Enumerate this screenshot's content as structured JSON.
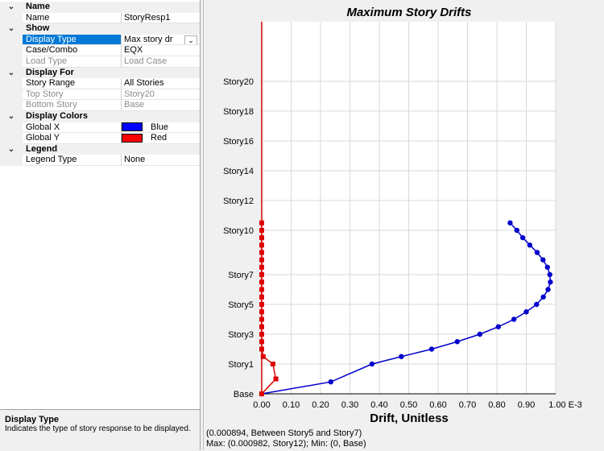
{
  "properties": [
    {
      "type": "cat",
      "label": "Name"
    },
    {
      "type": "row",
      "name": "Name",
      "value": "StoryResp1"
    },
    {
      "type": "cat",
      "label": "Show"
    },
    {
      "type": "row",
      "name": "Display Type",
      "value": "Max story dr",
      "selected": true,
      "dropdown": true
    },
    {
      "type": "row",
      "name": "Case/Combo",
      "value": "EQX"
    },
    {
      "type": "row",
      "name": "Load Type",
      "value": "Load Case",
      "dim": true
    },
    {
      "type": "cat",
      "label": "Display For"
    },
    {
      "type": "row",
      "name": "Story Range",
      "value": "All Stories"
    },
    {
      "type": "row",
      "name": "Top Story",
      "value": "Story20",
      "dim": true
    },
    {
      "type": "row",
      "name": "Bottom Story",
      "value": "Base",
      "dim": true
    },
    {
      "type": "cat",
      "label": "Display Colors"
    },
    {
      "type": "row",
      "name": "Global X",
      "value": "Blue",
      "swatch": "#0000ff"
    },
    {
      "type": "row",
      "name": "Global Y",
      "value": "Red",
      "swatch": "#ff0000"
    },
    {
      "type": "cat",
      "label": "Legend"
    },
    {
      "type": "row",
      "name": "Legend Type",
      "value": "None"
    }
  ],
  "description": {
    "title": "Display Type",
    "text": "Indicates the type of story response to be displayed."
  },
  "status": {
    "line1": "(0.000894, Between Story5 and Story7)",
    "line2": "Max: (0.000982, Story12);  Min: (0, Base)"
  },
  "chart_data": {
    "type": "line",
    "title": "Maximum Story Drifts",
    "xlabel": "Drift, Unitless",
    "xlim": [
      0,
      1.0
    ],
    "x_ticks": [
      "0.00",
      "0.10",
      "0.20",
      "0.30",
      "0.40",
      "0.50",
      "0.60",
      "0.70",
      "0.80",
      "0.90",
      "1.00 E-3"
    ],
    "y_labels": [
      {
        "label": "Base",
        "level": 0
      },
      {
        "label": "Story1",
        "level": 1
      },
      {
        "label": "Story3",
        "level": 3
      },
      {
        "label": "Story5",
        "level": 5
      },
      {
        "label": "Story7",
        "level": 7
      },
      {
        "label": "Story10",
        "level": 10
      },
      {
        "label": "Story12",
        "level": 12
      },
      {
        "label": "Story14",
        "level": 14
      },
      {
        "label": "Story16",
        "level": 16
      },
      {
        "label": "Story18",
        "level": 18
      },
      {
        "label": "Story20",
        "level": 20
      }
    ],
    "grid": true,
    "series": [
      {
        "name": "Global X",
        "color": "#0000cc",
        "points": [
          [
            0,
            0
          ],
          [
            0.235,
            0.4
          ],
          [
            0.375,
            1.0
          ],
          [
            0.475,
            1.5
          ],
          [
            0.578,
            2.0
          ],
          [
            0.665,
            2.5
          ],
          [
            0.742,
            3.0
          ],
          [
            0.805,
            3.5
          ],
          [
            0.858,
            4.0
          ],
          [
            0.9,
            4.5
          ],
          [
            0.935,
            5.0
          ],
          [
            0.958,
            5.5
          ],
          [
            0.974,
            6.0
          ],
          [
            0.982,
            6.5
          ],
          [
            0.98,
            7.0
          ],
          [
            0.972,
            7.5
          ],
          [
            0.957,
            8.0
          ],
          [
            0.937,
            8.5
          ],
          [
            0.912,
            9.0
          ],
          [
            0.888,
            9.5
          ],
          [
            0.868,
            10.0
          ],
          [
            0.845,
            10.5
          ]
        ]
      },
      {
        "name": "Global Y",
        "color": "#dd0000",
        "points": [
          [
            0,
            0
          ],
          [
            0.048,
            0.5
          ],
          [
            0.038,
            1.0
          ],
          [
            0.005,
            1.5
          ],
          [
            0,
            2.0
          ],
          [
            0,
            2.5
          ],
          [
            0,
            3.0
          ],
          [
            0,
            3.5
          ],
          [
            0,
            4.0
          ],
          [
            0,
            4.5
          ],
          [
            0,
            5.0
          ],
          [
            0,
            5.5
          ],
          [
            0,
            6.0
          ],
          [
            0,
            6.5
          ],
          [
            0,
            7.0
          ],
          [
            0,
            7.5
          ],
          [
            0,
            8.0
          ],
          [
            0,
            8.5
          ],
          [
            0,
            9.0
          ],
          [
            0,
            9.5
          ],
          [
            0,
            10.0
          ],
          [
            0,
            10.5
          ]
        ]
      }
    ]
  }
}
